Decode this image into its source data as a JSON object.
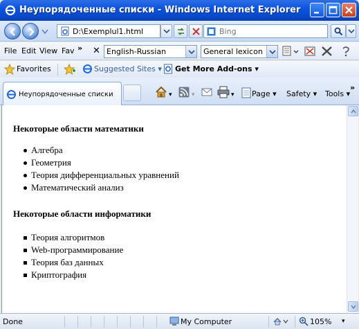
{
  "window": {
    "title": "Неупорядоченные списки - Windows Internet Explorer"
  },
  "navigation": {
    "address": "D:\\Exemplul1.html",
    "search_placeholder": "Bing"
  },
  "menubar": {
    "items": [
      "File",
      "Edit",
      "View",
      "Fav"
    ],
    "overflow": "»",
    "close_glyph": "✕",
    "translate_combo": "English-Russian",
    "lexicon_combo": "General lexicon"
  },
  "favorites_bar": {
    "favorites": "Favorites",
    "suggested_sites": "Suggested Sites ▾",
    "get_addons": "Get More Add-ons ▾"
  },
  "tabs": {
    "active_tab": "Неупорядоченные списки",
    "commands": [
      "Page ▾",
      "Safety ▾",
      "Tools ▾"
    ],
    "overflow": "»"
  },
  "page": {
    "heading_math": "Некоторые области математики",
    "math_items": [
      "Алгебра",
      "Геометрия",
      "Теория дифференциальных уравнений",
      "Математический анализ"
    ],
    "heading_cs": "Некоторые области информатики",
    "cs_items": [
      "Теория алгоритмов",
      "Web-программирование",
      "Теория баз данных",
      "Криптография"
    ]
  },
  "statusbar": {
    "status": "Done",
    "zone": "My Computer",
    "zoom": "105%"
  },
  "colors": {
    "titlebar": "#0A54E0",
    "chrome": "#DCE9FB",
    "content_bg": "#FFFFFF"
  },
  "icons": [
    "ie-icon",
    "minimize-icon",
    "maximize-icon",
    "close-icon",
    "back-icon",
    "forward-icon",
    "refresh-icon",
    "stop-icon",
    "search-icon",
    "favorites-star-icon",
    "home-icon",
    "feeds-icon",
    "mail-icon",
    "print-icon",
    "my-computer-icon",
    "zoom-icon"
  ]
}
